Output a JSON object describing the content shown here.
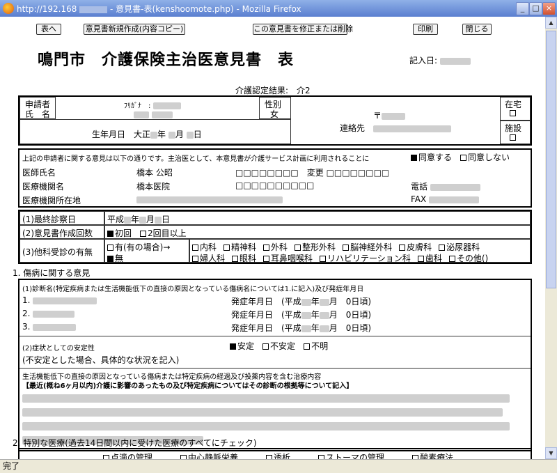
{
  "window": {
    "title_prefix": "http://192.168",
    "title_suffix": " - 意見書-表(kenshoomote.php) - Mozilla Firefox",
    "min": "_",
    "max": "□",
    "close": "×"
  },
  "status": "完了",
  "toolbar": {
    "back": "表へ",
    "new_copy": "意見書新規作成(内容コピー)",
    "edit_delete": "この意見書を修正または削除",
    "print": "印刷",
    "close": "閉じる"
  },
  "doc": {
    "title": "鳴門市　介護保険主治医意見書　表",
    "entry_date_label": "記入日:",
    "care_result": "介護認定結果:　介2"
  },
  "applicant": {
    "label1": "申請者",
    "label2": "氏　名",
    "furigana": "ﾌﾘｶﾞﾅ　:",
    "birth_prefix": "生年月日　大正",
    "year": "年",
    "month": "月",
    "day": "日",
    "gender_label": "性別",
    "gender": "女",
    "postal": "〒",
    "contact": "連絡先",
    "home": "在宅",
    "facility": "施設"
  },
  "doctor": {
    "agreement": "上記の申請者に関する意見は以下の通りです。主治医として、本意見書が介護サービス計画に利用されることに",
    "agree": "同意する",
    "disagree": "同意しない",
    "name_label": "医師氏名",
    "name": "橋本 公昭",
    "name_boxes": "□□□□□□□□",
    "change_label": "変更",
    "change_boxes": "□□□□□□□□",
    "inst_label": "医療機関名",
    "inst": "橋本医院",
    "inst_boxes": "□□□□□□□□□□",
    "phone_label": "電話",
    "addr_label": "医療機関所在地",
    "fax_label": "FAX"
  },
  "visit": {
    "last_label": "(1)最終診察日",
    "last_value": "平成",
    "last_year": "年",
    "last_month": "月",
    "last_day": "日",
    "count_label": "(2)意見書作成回数",
    "first": "初回",
    "second": "2回目以上",
    "other_label": "(3)他科受診の有無",
    "yes": "有(有の場合)→",
    "no": "無",
    "depts_row1": [
      "内科",
      "精神科",
      "外科",
      "整形外科",
      "脳神経外科",
      "皮膚科",
      "泌尿器科"
    ],
    "depts_row2": [
      "婦人科",
      "眼科",
      "耳鼻咽喉科",
      "リハビリテーション科",
      "歯科",
      "その他()"
    ]
  },
  "section1": {
    "title": "1. 傷病に関する意見",
    "diag_label": "(1)診断名(特定疾病または生活機能低下の直接の原因となっている傷病名については1.に記入)及び発症年月日",
    "items": [
      "1.",
      "2.",
      "3."
    ],
    "onset": "発症年月日　(平成",
    "onset_year": "年",
    "onset_tail": "月　0日頃)",
    "stability_label": "(2)症状としての安定性",
    "stable": "安定",
    "unstable": "不安定",
    "unknown": "不明",
    "unstable_note": "(不安定とした場合、具体的な状況を記入)",
    "course_line1": "生活機能低下の直接の原因となっている傷病または特定疾病の経過及び投薬内容を含む治療内容",
    "course_line2": "【最近(概ね6ヶ月以内)介護に影響のあったもの及び特定疾病についてはその診断の根拠等について記入】"
  },
  "section2": {
    "title": "2. 特別な医療(過去14日間以内に受けた医療のすべてにチェック)",
    "items": [
      "点滴の管理",
      "中心静脈栄養",
      "透析",
      "ストーマの管理",
      "酸素療法"
    ]
  }
}
